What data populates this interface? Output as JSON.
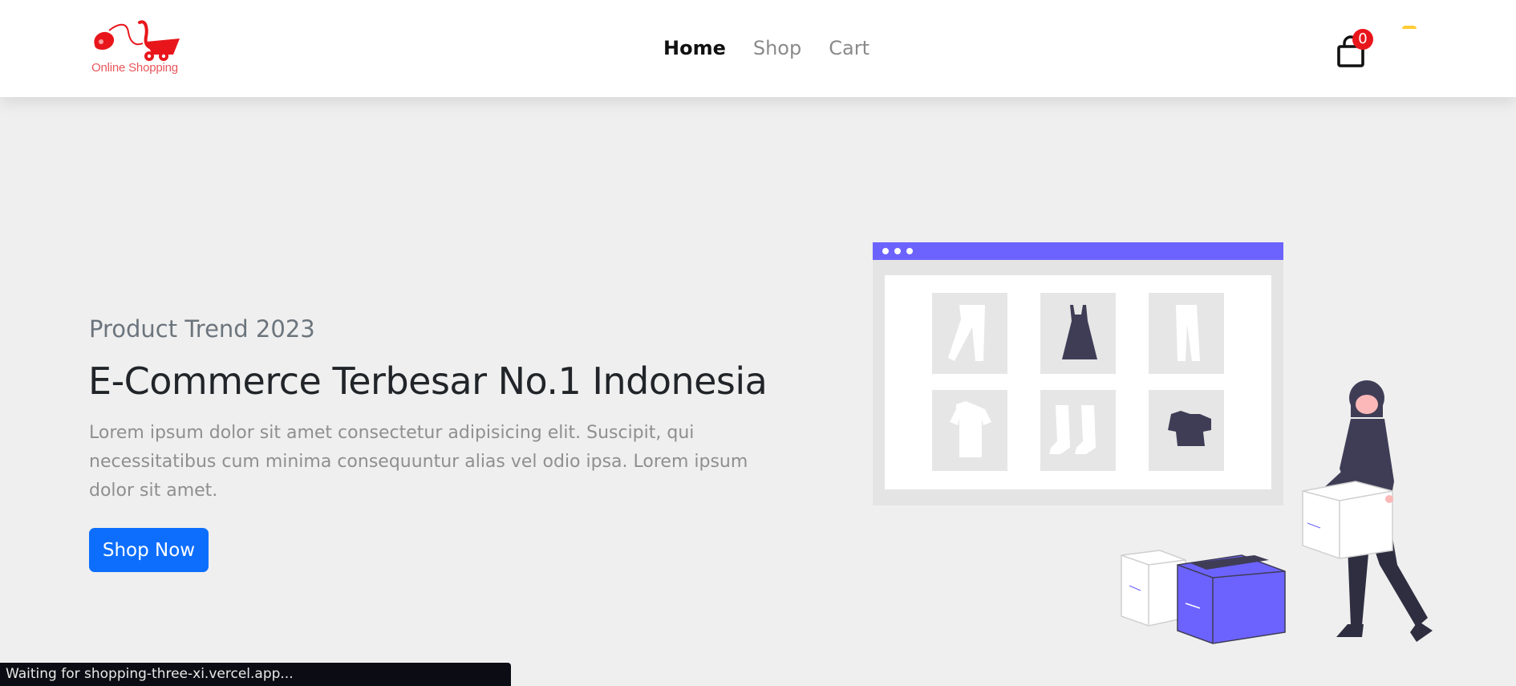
{
  "brand": {
    "logo_text": "Online Shopping",
    "accent": "#e8161b"
  },
  "nav": {
    "links": [
      {
        "label": "Home",
        "active": true
      },
      {
        "label": "Shop",
        "active": false
      },
      {
        "label": "Cart",
        "active": false
      }
    ]
  },
  "cart": {
    "count": "0"
  },
  "hero": {
    "subtitle": "Product Trend 2023",
    "title": "E-Commerce Terbesar No.1 Indonesia",
    "description": "Lorem ipsum dolor sit amet consectetur adipisicing elit. Suscipit, qui necessitatibus cum minima consequuntur alias vel odio ipsa. Lorem ipsum dolor sit amet.",
    "button_label": "Shop Now"
  },
  "status": {
    "text": "Waiting for shopping-three-xi.vercel.app..."
  },
  "colors": {
    "primary": "#0d6efd",
    "illustration_accent": "#6c63ff",
    "dark": "#3f3d56"
  }
}
